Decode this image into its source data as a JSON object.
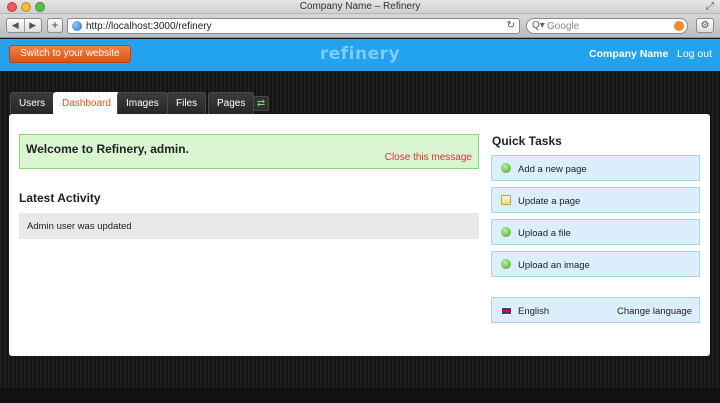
{
  "browser": {
    "window_title": "Company Name – Refinery",
    "url": "http://localhost:3000/refinery",
    "search_placeholder": "Google",
    "back_glyph": "◀",
    "forward_glyph": "▶",
    "plus_glyph": "+",
    "reload_glyph": "↻",
    "search_glyph": "Q▾",
    "gear_glyph": "⚙",
    "resize_glyph": "⤢"
  },
  "header": {
    "switch_button": "Switch to your website",
    "logo": "refinery",
    "company": "Company Name",
    "logout": "Log out",
    "bar_color": "#23a2ef"
  },
  "tabs": [
    {
      "label": "Users",
      "active": false
    },
    {
      "label": "Dashboard",
      "active": true
    },
    {
      "label": "Images",
      "active": false
    },
    {
      "label": "Files",
      "active": false
    },
    {
      "label": "Pages",
      "active": false
    }
  ],
  "tab_more_glyph": "⇄",
  "flash": {
    "message": "Welcome to Refinery, admin.",
    "close_label": "Close this message"
  },
  "activity": {
    "heading": "Latest Activity",
    "items": [
      "Admin user was updated"
    ]
  },
  "quick_tasks": {
    "heading": "Quick Tasks",
    "items": [
      {
        "label": "Add a new page",
        "icon": "add-icon"
      },
      {
        "label": "Update a page",
        "icon": "page-icon"
      },
      {
        "label": "Upload a file",
        "icon": "add-icon"
      },
      {
        "label": "Upload an image",
        "icon": "add-icon"
      }
    ]
  },
  "language": {
    "current": "English",
    "change_label": "Change language",
    "flag_icon": "uk-flag-icon"
  }
}
